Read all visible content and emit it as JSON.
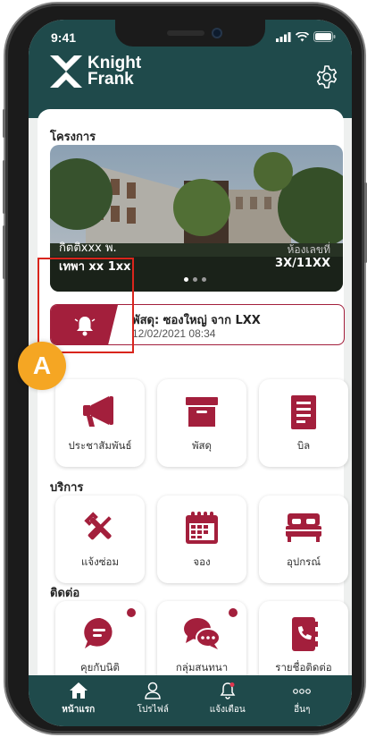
{
  "status_bar": {
    "time": "9:41"
  },
  "brand": {
    "line1": "Knight",
    "line2": "Frank"
  },
  "sections": {
    "project": "โครงการ",
    "services": "บริการ",
    "contact": "ติดต่อ"
  },
  "banner": {
    "project_name": "กิตติxxx พ.",
    "unit_name": "เทพา xx 1xx",
    "room_label": "ห้องเลขที่",
    "room_number": "3X/11XX",
    "slide_count": 3,
    "active_slide": 1
  },
  "notification": {
    "title": "พัสดุ: ซองใหญ่ จาก LXX",
    "time": "12/02/2021 08:34"
  },
  "callout": {
    "label": "A"
  },
  "menu": {
    "announcements": "ประชาสัมพันธ์",
    "parcel": "พัสดุ",
    "bill": "บิล",
    "repair": "แจ้งซ่อม",
    "booking": "จอง",
    "equipment": "อุปกรณ์",
    "chat_juristic": "คุยกับนิติ",
    "group_chat": "กลุ่มสนทนา",
    "contacts": "รายชื่อติดต่อ"
  },
  "bottom_nav": {
    "home": "หน้าแรก",
    "profile": "โปรไฟล์",
    "notifications": "แจ้งเตือน",
    "more": "อื่นๆ",
    "active": "home"
  },
  "colors": {
    "brand_green": "#1f4a4b",
    "accent": "#a31f3c",
    "highlight": "#d9251c",
    "badge": "#f5a623"
  }
}
